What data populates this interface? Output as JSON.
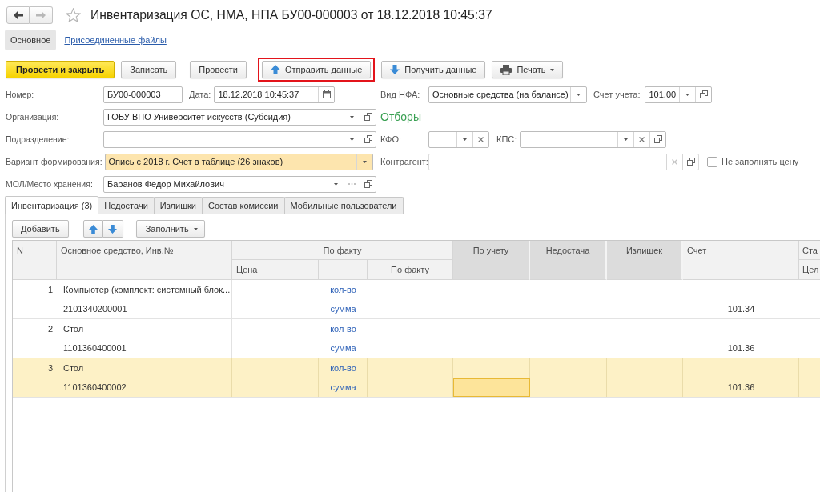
{
  "window": {
    "title": "Инвентаризация ОС, НМА, НПА БУ00-000003 от 18.12.2018 10:45:37"
  },
  "navigation": {
    "back": {
      "disabled": false
    },
    "forward": {
      "disabled": true
    }
  },
  "sections": [
    {
      "label": "Основное",
      "selected": true
    },
    {
      "label": "Присоединенные файлы",
      "selected": false
    }
  ],
  "command_bar": [
    {
      "label": "Провести и закрыть",
      "kind": "primary",
      "highlighted": false
    },
    {
      "label": "Записать",
      "kind": "plain",
      "highlighted": false
    },
    {
      "label": "Провести",
      "kind": "plain",
      "highlighted": false
    },
    {
      "label": "Отправить данные",
      "kind": "upload",
      "highlighted": true
    },
    {
      "label": "Получить данные",
      "kind": "download",
      "highlighted": false
    },
    {
      "label": "Печать",
      "kind": "print",
      "highlighted": false
    }
  ],
  "fields": {
    "number": {
      "label": "Номер:",
      "value": "БУ00-000003"
    },
    "date": {
      "label": "Дата:",
      "value": "18.12.2018 10:45:37"
    },
    "nfa_type": {
      "label": "Вид НФА:",
      "value": "Основные средства (на балансе)"
    },
    "account": {
      "label": "Счет учета:",
      "value": "101.00"
    },
    "organization": {
      "label": "Организация:",
      "value": "ГОБУ ВПО Университет искусств (Субсидия)"
    },
    "filters_heading": "Отборы",
    "subdivision": {
      "label": "Подразделение:"
    },
    "kfo": {
      "label": "КФО:"
    },
    "kps": {
      "label": "КПС:"
    },
    "variant": {
      "label": "Вариант формирования:",
      "value": "Опись с 2018 г. Счет в таблице (26 знаков)",
      "highlighted": true
    },
    "counterparty": {
      "label": "Контрагент:",
      "disabled": true
    },
    "no_price": {
      "label": "Не заполнять цену",
      "checked": false
    },
    "mol": {
      "label": "МОЛ/Место хранения:",
      "value": "Баранов Федор Михайлович"
    }
  },
  "tabs": [
    {
      "label": "Инвентаризация (3)",
      "selected": true
    },
    {
      "label": "Недостачи",
      "selected": false
    },
    {
      "label": "Излишки",
      "selected": false
    },
    {
      "label": "Состав комиссии",
      "selected": false
    },
    {
      "label": "Мобильные пользователи",
      "selected": false
    }
  ],
  "table_toolbar": {
    "add": "Добавить",
    "fill": "Заполнить"
  },
  "table": {
    "header": {
      "n": "N",
      "asset": "Основное средство, Инв.№",
      "fact_group": "По факту",
      "price": "Цена",
      "fact": "По факту",
      "by_account": "По учету",
      "shortage": "Недостача",
      "surplus": "Излишек",
      "account": "Счет",
      "column_10": "Ста",
      "column_10_sub": "Цел"
    },
    "rows": [
      {
        "n": "1",
        "asset": "Компьютер (комплект: системный блок...",
        "inv_number": "2101340200001",
        "qty_label": "кол-во",
        "sum_label": "сумма",
        "account": "101.34",
        "selected": false,
        "focused": false
      },
      {
        "n": "2",
        "asset": "Стол",
        "inv_number": "1101360400001",
        "qty_label": "кол-во",
        "sum_label": "сумма",
        "account": "101.36",
        "selected": false,
        "focused": false
      },
      {
        "n": "3",
        "asset": "Стол",
        "inv_number": "1101360400002",
        "qty_label": "кол-во",
        "sum_label": "сумма",
        "account": "101.36",
        "selected": true,
        "focused": true
      }
    ]
  }
}
